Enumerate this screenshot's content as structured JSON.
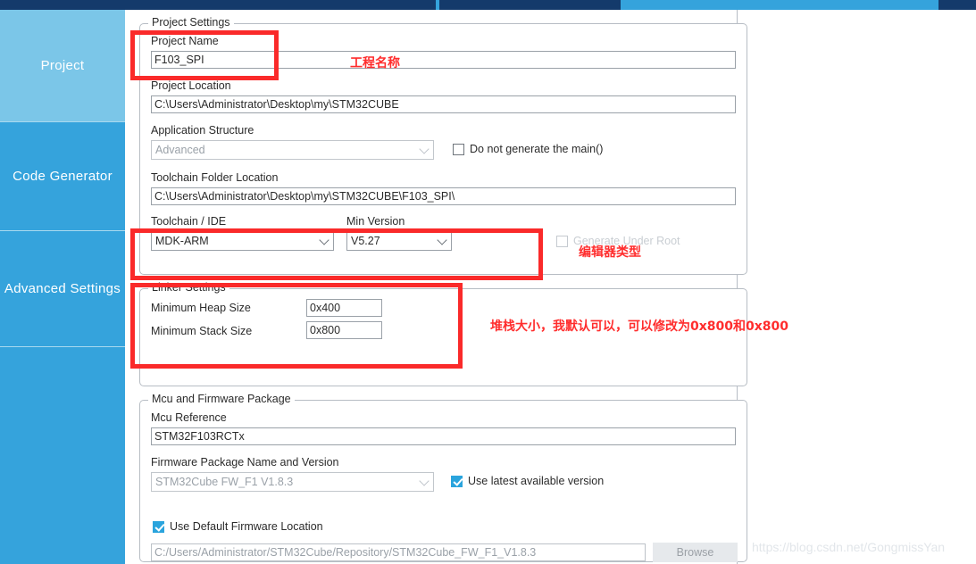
{
  "window": {
    "topbar_dark_color": "#143a6b",
    "topbar_accent_color": "#35a3dc"
  },
  "sidebar": {
    "selected_color": "#7bc6e8",
    "base_color": "#35a3dc",
    "items": [
      {
        "label": "Project",
        "selected": true
      },
      {
        "label": "Code Generator",
        "selected": false
      },
      {
        "label": "Advanced Settings",
        "selected": false
      },
      {
        "label": "",
        "selected": false
      }
    ]
  },
  "project_settings": {
    "legend": "Project Settings",
    "project_name_label": "Project Name",
    "project_name_value": "F103_SPI",
    "project_location_label": "Project Location",
    "project_location_value": "C:\\Users\\Administrator\\Desktop\\my\\STM32CUBE",
    "application_structure_label": "Application Structure",
    "application_structure_value": "Advanced",
    "do_not_generate_main_label": "Do not generate the main()",
    "do_not_generate_main_checked": false,
    "toolchain_folder_label": "Toolchain Folder Location",
    "toolchain_folder_value": "C:\\Users\\Administrator\\Desktop\\my\\STM32CUBE\\F103_SPI\\",
    "toolchain_ide_label": "Toolchain / IDE",
    "toolchain_ide_value": "MDK-ARM",
    "min_version_label": "Min Version",
    "min_version_value": "V5.27",
    "generate_under_root_label": "Generate Under Root",
    "generate_under_root_checked": false
  },
  "linker_settings": {
    "legend": "Linker Settings",
    "min_heap_label": "Minimum Heap Size",
    "min_heap_value": "0x400",
    "min_stack_label": "Minimum Stack Size",
    "min_stack_value": "0x800"
  },
  "mcu_firmware": {
    "legend": "Mcu and Firmware Package",
    "mcu_reference_label": "Mcu Reference",
    "mcu_reference_value": "STM32F103RCTx",
    "firmware_package_label": "Firmware Package Name and Version",
    "firmware_package_value": "STM32Cube FW_F1 V1.8.3",
    "use_latest_label": "Use latest available version",
    "use_latest_checked": true,
    "use_default_location_label": "Use Default Firmware Location",
    "use_default_location_checked": true,
    "firmware_location_value": "C:/Users/Administrator/STM32Cube/Repository/STM32Cube_FW_F1_V1.8.3",
    "browse_label": "Browse"
  },
  "annotations": {
    "color": "#ff2d2d",
    "project_name_note": "工程名称",
    "editor_type_note": "编辑器类型",
    "heap_stack_note": "堆栈大小，我默认可以，可以修改为0x800和0x800"
  },
  "watermark": {
    "text": "https://blog.csdn.net/GongmissYan"
  }
}
